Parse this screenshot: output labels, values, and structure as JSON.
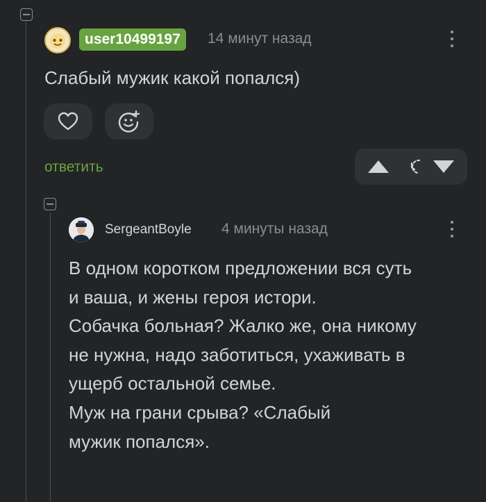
{
  "comment": {
    "username": "user10499197",
    "timestamp": "14 минут назад",
    "text": "Слабый мужик какой попался)",
    "reply_label": "ответить",
    "icons": {
      "collapse": "collapse-minus-icon",
      "avatar": "user-avatar",
      "more": "kebab-menu-icon",
      "like": "heart-icon",
      "reaction": "add-emoji-icon",
      "upvote": "triangle-up-icon",
      "timer": "clock-icon",
      "downvote": "triangle-down-icon"
    }
  },
  "reply": {
    "username": "SergeantBoyle",
    "timestamp": "4 минуты назад",
    "lines": [
      "В одном коротком предложении вся суть",
      "и ваша, и жены героя истори.",
      "Собачка больная? Жалко же, она никому",
      "не нужна, надо заботиться, ухаживать в",
      "ущерб остальной семье.",
      "Муж на грани срыва? «Слабый",
      "мужик попался»."
    ]
  },
  "colors": {
    "background": "#232425",
    "accent_green": "#68a341",
    "text": "#d3d4d6",
    "muted": "#8a8c90"
  }
}
